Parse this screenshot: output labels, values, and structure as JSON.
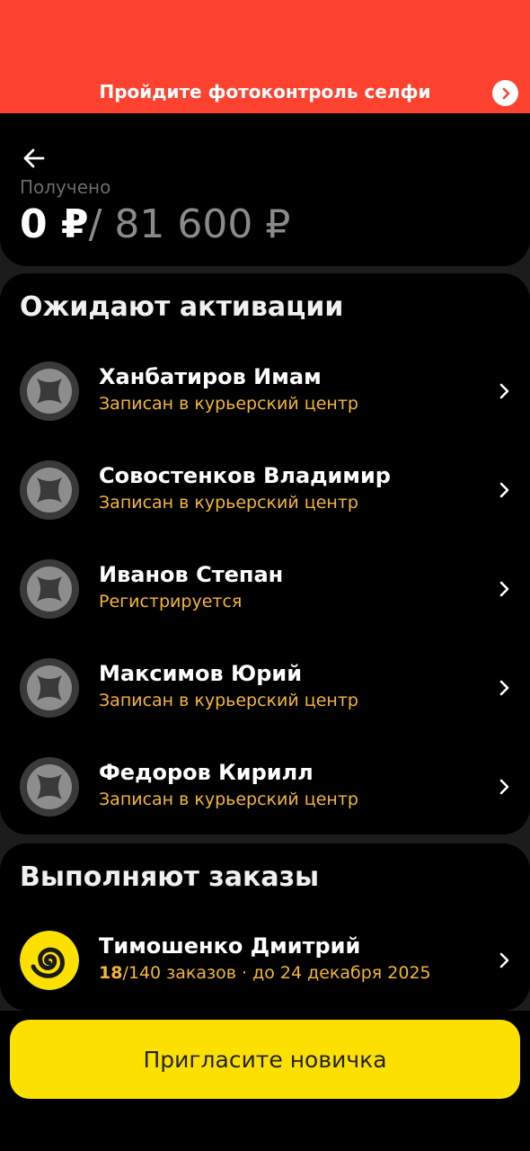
{
  "banner": {
    "text": "Пройдите фотоконтроль селфи"
  },
  "header": {
    "received_label": "Получено",
    "amount_received": "0 ₽",
    "amount_total": "/ 81 600 ₽"
  },
  "awaiting": {
    "title": "Ожидают активации",
    "items": [
      {
        "name": "Ханбатиров Имам",
        "status": "Записан в курьерский центр"
      },
      {
        "name": "Совостенков Владимир",
        "status": "Записан в курьерский центр"
      },
      {
        "name": "Иванов Степан",
        "status": "Регистрируется"
      },
      {
        "name": "Максимов Юрий",
        "status": "Записан в курьерский центр"
      },
      {
        "name": "Федоров Кирилл",
        "status": "Записан в курьерский центр"
      }
    ]
  },
  "active": {
    "title": "Выполняют заказы",
    "items": [
      {
        "name": "Тимошенко Дмитрий",
        "orders_done": "18",
        "orders_rest": "/140 заказов · до 24 декабря 2025"
      }
    ]
  },
  "invite_button": {
    "label": "Пригласите новичка"
  },
  "colors": {
    "banner": "#fd4230",
    "status": "#f5b633",
    "button": "#fce000"
  }
}
